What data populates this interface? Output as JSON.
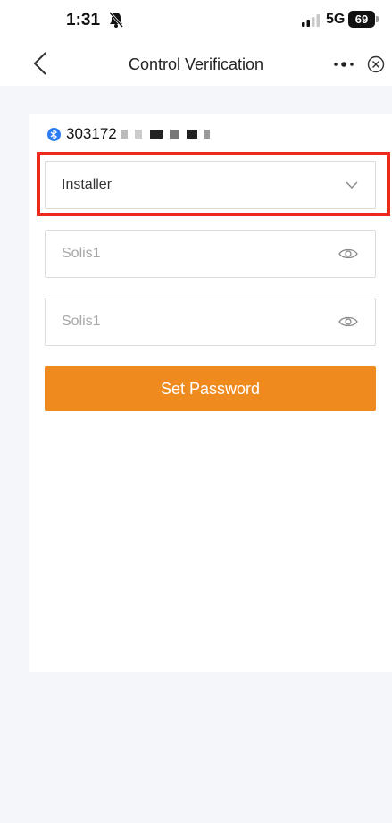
{
  "status_bar": {
    "time": "1:31",
    "network": "5G",
    "battery": "69"
  },
  "nav": {
    "title": "Control Verification"
  },
  "device": {
    "id_prefix": "303172"
  },
  "form": {
    "role_value": "Installer",
    "password_placeholder": "Solis1",
    "confirm_placeholder": "Solis1",
    "submit_label": "Set Password"
  },
  "colors": {
    "accent": "#ef8a1e",
    "highlight_frame": "#ee2a1c",
    "bluetooth": "#2d7cf6"
  }
}
